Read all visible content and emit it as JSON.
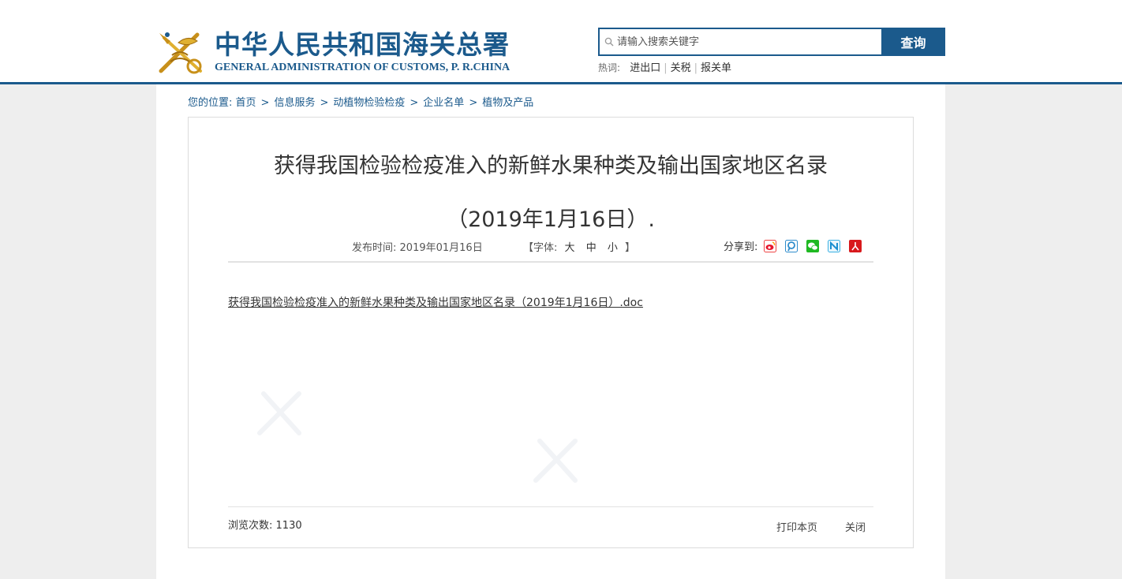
{
  "header": {
    "logo_cn": "中华人民共和国海关总署",
    "logo_en": "GENERAL ADMINISTRATION OF CUSTOMS, P. R.CHINA",
    "search": {
      "placeholder": "请输入搜索关键字",
      "value": "",
      "button": "查询"
    },
    "hot": {
      "label": "热词:",
      "items": [
        "进出口",
        "关税",
        "报关单"
      ]
    }
  },
  "breadcrumb": {
    "label": "您的位置:",
    "items": [
      "首页",
      "信息服务",
      "动植物检验检疫",
      "企业名单",
      "植物及产品"
    ],
    "separator": ">"
  },
  "article": {
    "title_line1": "获得我国检验检疫准入的新鲜水果种类及输出国家地区名录",
    "title_line2": "（2019年1月16日）.",
    "publish_label": "发布时间:",
    "publish_date": "2019年01月16日",
    "font_label_open": "【字体:",
    "font_sizes": [
      "大",
      "中",
      "小"
    ],
    "font_label_close": "】",
    "share_label": "分享到:",
    "share_icons": [
      "weibo-icon",
      "tencent-weibo-icon",
      "wechat-icon",
      "renren-icon",
      "pdf-icon"
    ],
    "attachment": "获得我国检验检疫准入的新鲜水果种类及输出国家地区名录（2019年1月16日）.doc",
    "views_label": "浏览次数:",
    "views_count": "1130",
    "print": "打印本页",
    "close": "关闭"
  },
  "colors": {
    "brand": "#1b5a8c",
    "gold": "#d9a21b",
    "background": "#eeeeee"
  }
}
